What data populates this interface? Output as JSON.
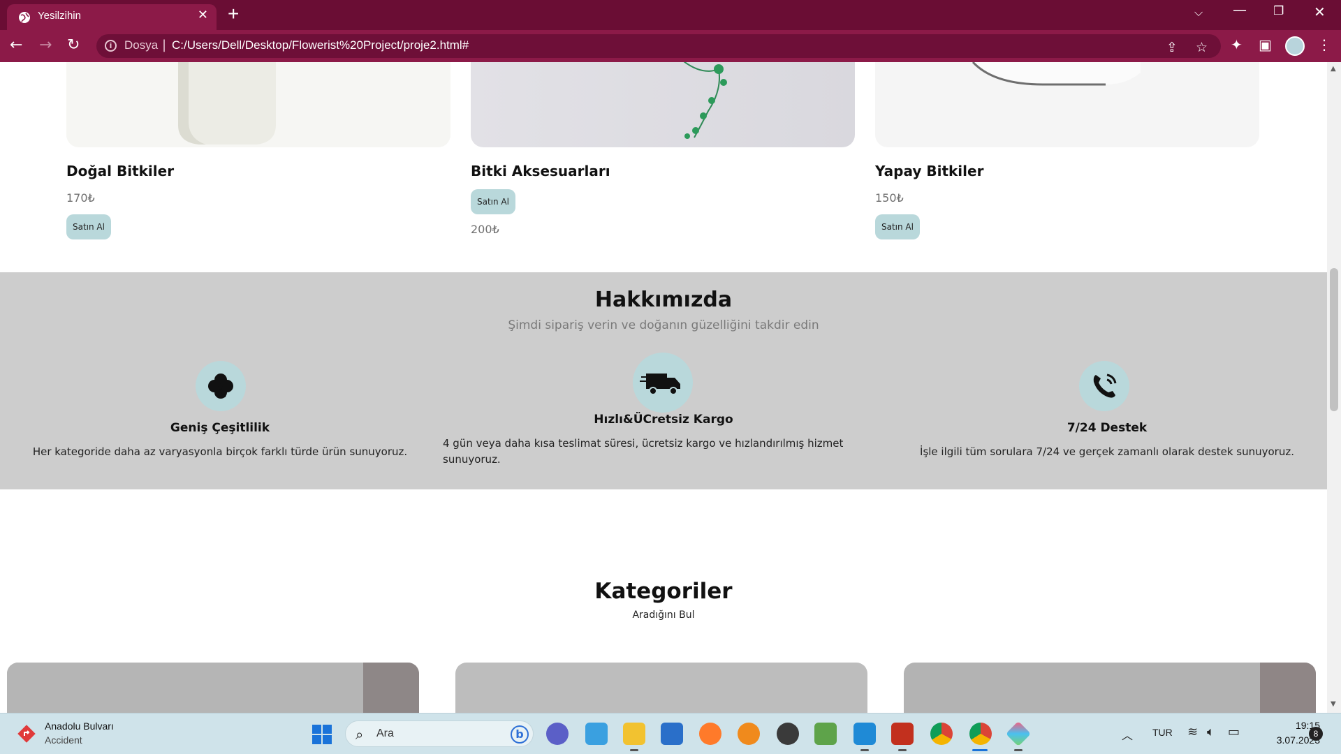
{
  "browser": {
    "tab_title": "Yesilzihin",
    "new_tab": "+",
    "tab_close": "✕",
    "address_scheme": "Dosya",
    "address_url": "C:/Users/Dell/Desktop/Flowerist%20Project/proje2.html#"
  },
  "products": [
    {
      "name": "Doğal Bitkiler",
      "price": "170₺",
      "buy_label": "Satın Al"
    },
    {
      "name": "Bitki Aksesuarları",
      "price": "200₺",
      "buy_label": "Satın Al"
    },
    {
      "name": "Yapay Bitkiler",
      "price": "150₺",
      "buy_label": "Satın Al"
    }
  ],
  "about": {
    "heading": "Hakkımızda",
    "subheading": "Şimdi sipariş verin ve doğanın güzelliğini takdir edin",
    "features": [
      {
        "title": "Geniş Çeşitlilik",
        "description": "Her kategoride daha az varyasyonla birçok farklı türde ürün sunuyoruz.",
        "icon": "clover-icon"
      },
      {
        "title": "Hızlı&ÜCretsiz Kargo",
        "description": "4 gün veya daha kısa teslimat süresi, ücretsiz kargo ve hızlandırılmış hizmet sunuyoruz.",
        "icon": "truck-icon"
      },
      {
        "title": "7/24 Destek",
        "description": "İşle ilgili tüm sorulara 7/24 ve gerçek zamanlı olarak destek sunuyoruz.",
        "icon": "phone-icon"
      }
    ]
  },
  "categories": {
    "heading": "Kategoriler",
    "subheading": "Aradığını Bul"
  },
  "taskbar": {
    "news_title": "Anadolu Bulvarı",
    "news_subtitle": "Accident",
    "search_placeholder": "Ara",
    "language": "TUR",
    "time": "19:15",
    "date": "3.07.2023",
    "notification_count": "8"
  },
  "colors": {
    "browser_frame": "#6a0d34",
    "toolbar": "#8c1a48",
    "button_accent": "#b9d8db",
    "about_background": "#cdcdcd"
  }
}
